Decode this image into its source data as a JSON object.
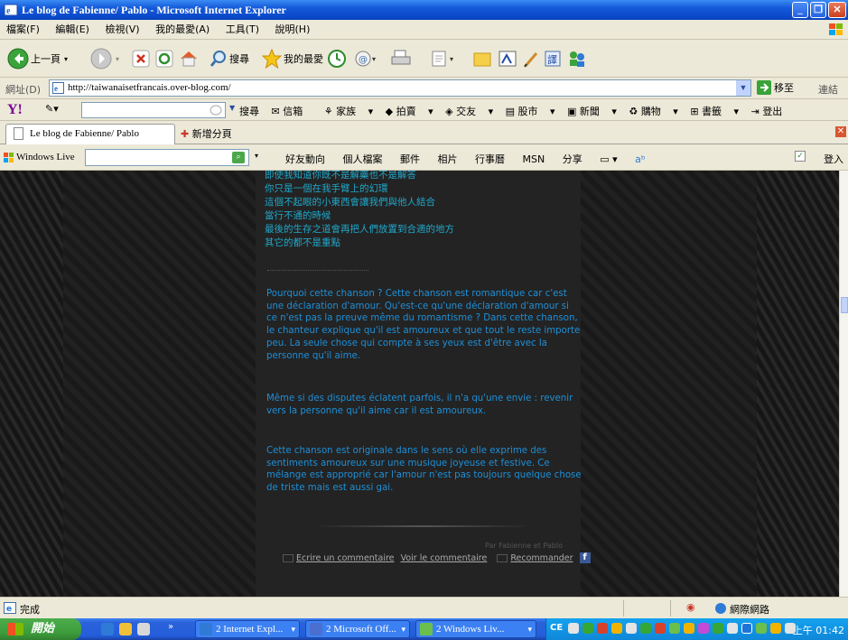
{
  "window": {
    "title": "Le blog de Fabienne/ Pablo - Microsoft Internet Explorer"
  },
  "menu": [
    "檔案(F)",
    "編輯(E)",
    "檢視(V)",
    "我的最愛(A)",
    "工具(T)",
    "說明(H)"
  ],
  "toolbar": {
    "back_label": "上一頁",
    "search_label": "搜尋",
    "favorites_label": "我的最愛"
  },
  "address": {
    "label": "網址(D)",
    "url": "http://taiwanaisetfrancais.over-blog.com/",
    "go_label": "移至",
    "links_label": "連結"
  },
  "yahoo": {
    "logo": "Y!",
    "search_label": "搜尋",
    "items": [
      "信箱",
      "家族",
      "拍賣",
      "交友",
      "股市",
      "新聞",
      "購物",
      "書籤",
      "登出"
    ]
  },
  "tabs": {
    "active": "Le blog de Fabienne/ Pablo",
    "new_tab": "新增分頁"
  },
  "live": {
    "brand": "Windows Live",
    "items": [
      "好友動向",
      "個人檔案",
      "郵件",
      "相片",
      "行事曆",
      "MSN",
      "分享"
    ],
    "login": "登入"
  },
  "content": {
    "chinese_lines": [
      "即使我知道你既不是解藥也不是解答",
      "你只是一個在我手臂上的幻環",
      "這個不起眼的小東西會讓我們與他人結合",
      "當行不通的時候",
      "最後的生存之道會再把人們放置到合適的地方",
      "其它的都不是重點"
    ],
    "para1": "Pourquoi cette chanson ? Cette chanson est romantique car c'est une déclaration d'amour. Qu'est-ce qu'une déclaration d'amour si ce n'est pas la preuve même du romantisme ? Dans cette chanson, le chanteur explique qu'il est amoureux et que tout le reste importe peu. La seule chose qui compte à ses yeux est d'être avec la personne qu'il aime.",
    "para2": "Même si des disputes éclatent parfois, il n'a qu'une envie : revenir vers la personne qu'il aime car il est amoureux.",
    "para3": "Cette chanson est originale dans le sens où elle exprime des sentiments amoureux sur une musique joyeuse et festive. Ce mélange est approprié car l'amour n'est pas toujours quelque chose de triste mais est aussi gai.",
    "byline": "Par Fabienne et Pablo",
    "comment_link": "Ecrire un commentaire",
    "view_comment_link": "Voir le commentaire",
    "recommend_link": "Recommander",
    "fb_letter": "f"
  },
  "status": {
    "text": "完成",
    "zone": "網際網路"
  },
  "taskbar": {
    "start": "開始",
    "buttons": [
      "2 Internet Expl...",
      "2 Microsoft Off...",
      "2 Windows Liv..."
    ],
    "tray_lang": "CE",
    "clock": "上午 01:42"
  },
  "colors": {
    "accent": "#1e8fd7",
    "cn_text": "#20a7c9",
    "background": "#1a1a1a"
  }
}
